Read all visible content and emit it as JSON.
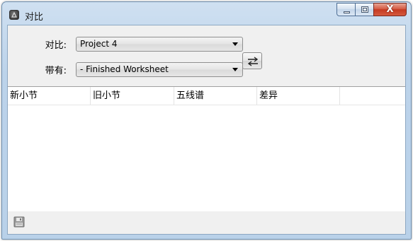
{
  "window": {
    "title": "对比",
    "app_icon": "app-logo-icon",
    "controls": [
      "minimize-icon",
      "maximize-icon",
      "close-icon"
    ],
    "close_glyph": "X"
  },
  "form": {
    "compare_label": "对比:",
    "compare_value": "Project 4",
    "with_label": "带有:",
    "with_value": "- Finished Worksheet",
    "swap_icon": "swap-arrows-icon"
  },
  "table": {
    "columns": [
      "新小节",
      "旧小节",
      "五线谱",
      "差异"
    ],
    "rows": []
  },
  "statusbar": {
    "save_icon": "save-icon"
  },
  "colors": {
    "titlebar": "#bcd3ea",
    "close_button": "#c53a22",
    "panel": "#f0f0f0"
  }
}
